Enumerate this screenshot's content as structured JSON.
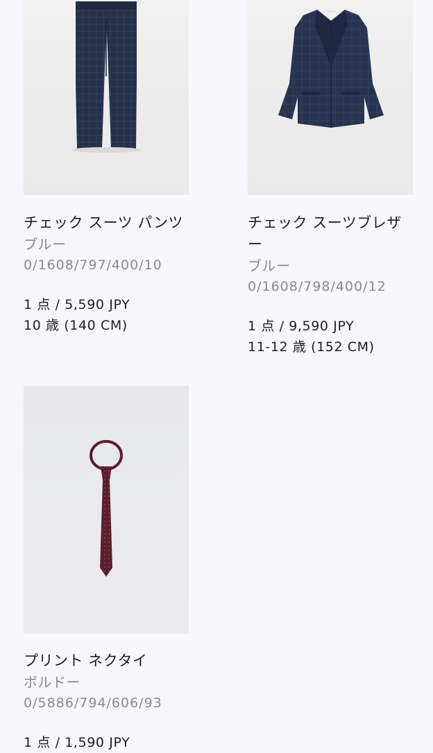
{
  "products": [
    {
      "name": "チェック スーツ パンツ",
      "color": "ブルー",
      "reference": "0/1608/797/400/10",
      "quantity_price": "1 点 / 5,590 JPY",
      "size": "10 歳 (140 CM)",
      "image_icon": "navy-check-trousers-image"
    },
    {
      "name": "チェック スーツブレザー",
      "color": "ブルー",
      "reference": "0/1608/798/400/12",
      "quantity_price": "1 点 / 9,590 JPY",
      "size": "11-12 歳 (152 CM)",
      "image_icon": "navy-check-blazer-image"
    },
    {
      "name": "プリント ネクタイ",
      "color": "ボルドー",
      "reference": "0/5886/794/606/93",
      "quantity_price": "1 点 / 1,590 JPY",
      "size": "",
      "image_icon": "burgundy-print-tie-image"
    }
  ],
  "colors": {
    "background": "#f7f7fc",
    "text_primary": "#1f1f1f",
    "text_secondary": "#8a8a8a",
    "navy": "#2a3550",
    "burgundy": "#5a1e2e"
  }
}
